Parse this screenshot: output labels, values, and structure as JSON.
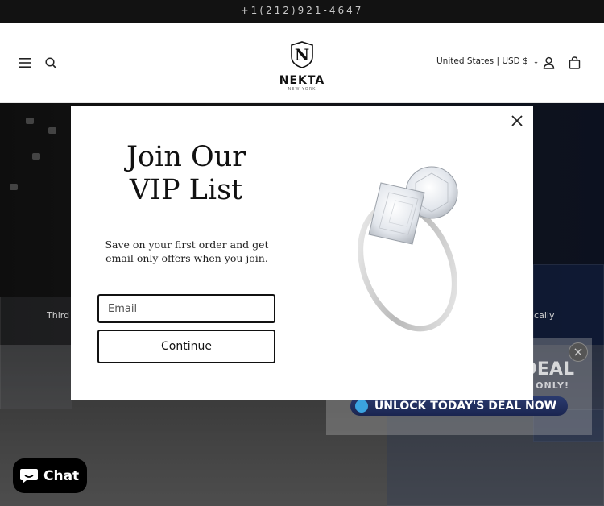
{
  "announcement": {
    "phone": "+1(212)921-4647"
  },
  "header": {
    "menu_icon": "hamburger-menu-icon",
    "search_icon": "search-icon",
    "logo": {
      "name": "NEKTA",
      "subtitle": "NEW YORK"
    },
    "locale_label": "United States | USD $",
    "account_icon": "user-icon",
    "cart_icon": "cart-icon"
  },
  "hero": {
    "left_text": "Third",
    "right_text": "ically"
  },
  "promo": {
    "headline": "DEAL",
    "subline": "ONLY!",
    "button_label": "UNLOCK TODAY'S DEAL NOW"
  },
  "modal": {
    "title_line1": "Join Our",
    "title_line2": "VIP List",
    "subtitle": "Save on your first order and get email only offers when you join.",
    "email_placeholder": "Email",
    "continue_label": "Continue",
    "close_icon": "close-icon",
    "image_icon": "diamond-ring-image"
  },
  "chat": {
    "label": "Chat"
  },
  "colors": {
    "announce_bg": "#121212",
    "chat_bg": "#000000",
    "promo_button": "#1a2550"
  }
}
